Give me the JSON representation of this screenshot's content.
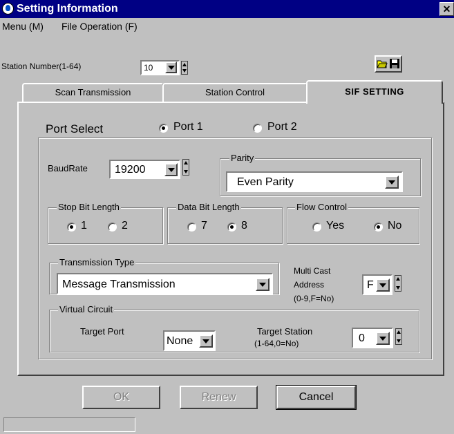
{
  "window": {
    "title": "Setting Information",
    "close_glyph": "✕"
  },
  "menu": {
    "items": [
      {
        "label": "Menu (M)"
      },
      {
        "label": "File Operation (F)"
      }
    ]
  },
  "station": {
    "label": "Station Number(1-64)",
    "value": "10"
  },
  "tabs": [
    {
      "label": "Scan Transmission"
    },
    {
      "label": "Station Control"
    },
    {
      "label": "SIF SETTING"
    }
  ],
  "port": {
    "label": "Port Select",
    "option1": "Port 1",
    "option2": "Port 2",
    "selected": "Port 1"
  },
  "baud": {
    "label": "BaudRate",
    "value": "19200"
  },
  "parity": {
    "label": "Parity",
    "value": "Even Parity"
  },
  "stop_bit": {
    "label": "Stop Bit Length",
    "opt1": "1",
    "opt2": "2",
    "selected": "1"
  },
  "data_bit": {
    "label": "Data Bit Length",
    "opt1": "7",
    "opt2": "8",
    "selected": "8"
  },
  "flow": {
    "label": "Flow Control",
    "opt1": "Yes",
    "opt2": "No",
    "selected": "No"
  },
  "transmission": {
    "label": "Transmission Type",
    "value": "Message Transmission"
  },
  "multicast": {
    "line1": "Multi Cast",
    "line2": "Address",
    "line3": "(0-9,F=No)",
    "value": "F"
  },
  "virtual": {
    "label": "Virtual Circuit",
    "target_port_label": "Target Port",
    "target_port_value": "None",
    "target_station_line1": "Target Station",
    "target_station_line2": "(1-64,0=No)",
    "target_station_value": "0"
  },
  "buttons": {
    "ok": "OK",
    "renew": "Renew",
    "cancel": "Cancel"
  },
  "icons": {
    "open": "folder-open-icon",
    "save": "floppy-disk-icon"
  }
}
